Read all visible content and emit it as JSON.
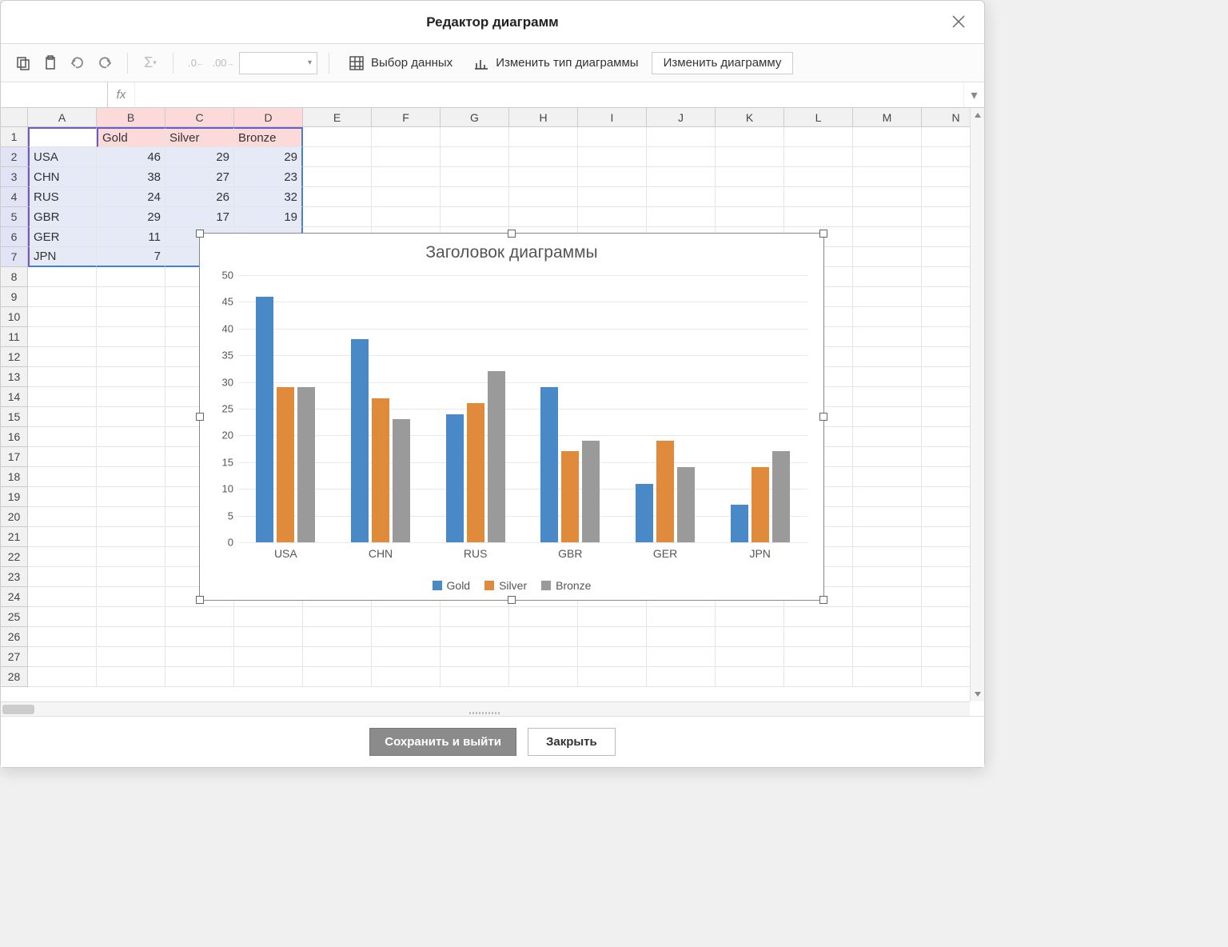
{
  "title": "Редактор диаграмм",
  "toolbar": {
    "select_data": "Выбор данных",
    "change_type": "Изменить тип диаграммы",
    "edit_chart": "Изменить диаграмму"
  },
  "formula_bar": {
    "name_box": "",
    "fx": "fx"
  },
  "columns": [
    "A",
    "B",
    "C",
    "D",
    "E",
    "F",
    "G",
    "H",
    "I",
    "J",
    "K",
    "L",
    "M",
    "N"
  ],
  "row_count": 28,
  "table": {
    "headers": [
      "Gold",
      "Silver",
      "Bronze"
    ],
    "rows": [
      {
        "label": "USA",
        "vals": [
          46,
          29,
          29
        ]
      },
      {
        "label": "CHN",
        "vals": [
          38,
          27,
          23
        ]
      },
      {
        "label": "RUS",
        "vals": [
          24,
          26,
          32
        ]
      },
      {
        "label": "GBR",
        "vals": [
          29,
          17,
          19
        ]
      },
      {
        "label": "GER",
        "vals": [
          11,
          19,
          14
        ]
      },
      {
        "label": "JPN",
        "vals": [
          7,
          14,
          17
        ]
      }
    ],
    "visible_override": {
      "5": {
        "silver": "1",
        "bronze": "1"
      },
      "6": {
        "silver": "",
        "bronze": ""
      }
    }
  },
  "chart_data": {
    "type": "bar",
    "title": "Заголовок диаграммы",
    "categories": [
      "USA",
      "CHN",
      "RUS",
      "GBR",
      "GER",
      "JPN"
    ],
    "series": [
      {
        "name": "Gold",
        "color": "#4a89c8",
        "values": [
          46,
          38,
          24,
          29,
          11,
          7
        ]
      },
      {
        "name": "Silver",
        "color": "#e08a3c",
        "values": [
          29,
          27,
          26,
          17,
          19,
          14
        ]
      },
      {
        "name": "Bronze",
        "color": "#9a9a9a",
        "values": [
          29,
          23,
          32,
          19,
          14,
          17
        ]
      }
    ],
    "ylim": [
      0,
      50
    ],
    "yticks": [
      0,
      5,
      10,
      15,
      20,
      25,
      30,
      35,
      40,
      45,
      50
    ]
  },
  "footer": {
    "save": "Сохранить и выйти",
    "close": "Закрыть"
  }
}
